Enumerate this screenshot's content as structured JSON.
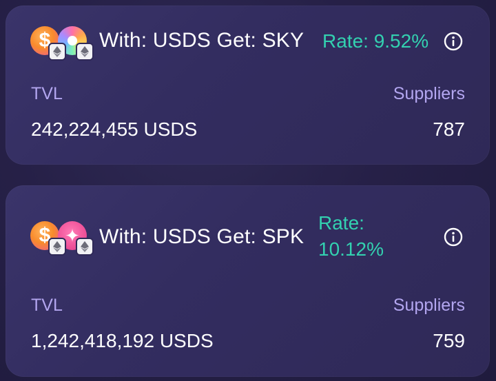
{
  "pools": [
    {
      "pair_label": "With: USDS Get: SKY",
      "rate_label": "Rate: 9.52%",
      "tvl_label": "TVL",
      "tvl_value": "242,224,455 USDS",
      "suppliers_label": "Suppliers",
      "suppliers_value": "787",
      "icons": [
        "usds-token-icon",
        "sky-token-icon",
        "ethereum-icon",
        "info-icon"
      ]
    },
    {
      "pair_label": "With: USDS Get: SPK",
      "rate_line1": "Rate:",
      "rate_line2": "10.12%",
      "tvl_label": "TVL",
      "tvl_value": "1,242,418,192 USDS",
      "suppliers_label": "Suppliers",
      "suppliers_value": "759",
      "icons": [
        "usds-token-icon",
        "spk-token-icon",
        "ethereum-icon",
        "info-icon"
      ]
    }
  ],
  "colors": {
    "background": "#262047",
    "card": "#352f63",
    "rate_accent": "#33d1b0",
    "label": "#b3a6f0",
    "text": "#ffffff"
  }
}
